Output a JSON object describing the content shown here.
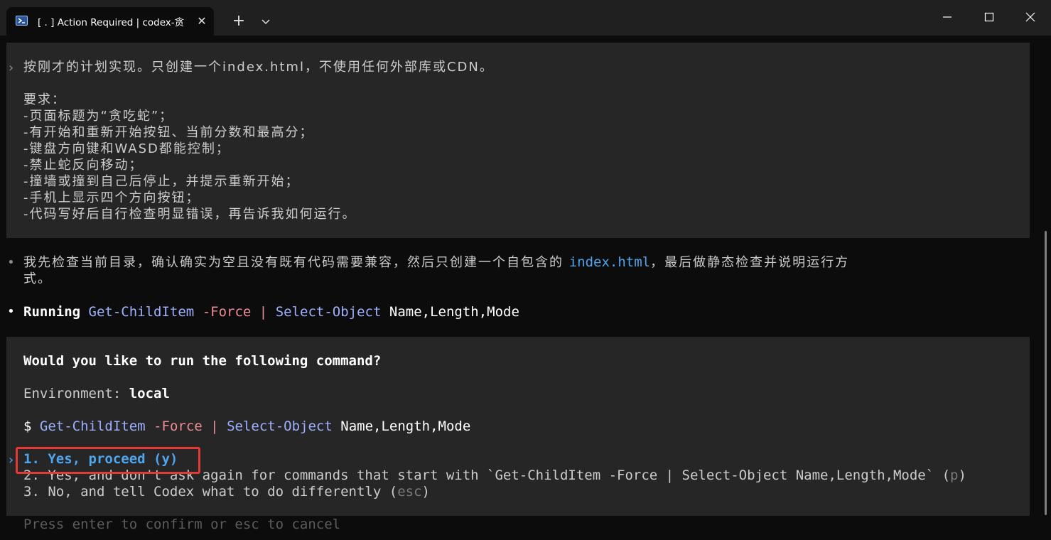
{
  "window": {
    "tab_title": "[ . ] Action Required | codex-贪",
    "tab_close": "✕",
    "new_tab": "+",
    "icons": {
      "tab": "terminal-powershell-icon",
      "dropdown": "chevron-down-icon",
      "minimize": "minimize-icon",
      "maximize": "maximize-icon",
      "close": "close-icon"
    }
  },
  "user_prompt": {
    "marker": "›",
    "first_line": "按刚才的计划实现。只创建一个index.html，不使用任何外部库或CDN。",
    "requirements_title": "要求：",
    "requirements": [
      "-页面标题为“贪吃蛇”；",
      "-有开始和重新开始按钮、当前分数和最高分；",
      "-键盘方向键和WASD都能控制；",
      "-禁止蛇反向移动；",
      "-撞墙或撞到自己后停止，并提示重新开始；",
      "-手机上显示四个方向按钮；",
      "-代码写好后自行检查明显错误，再告诉我如何运行。"
    ]
  },
  "assistant": {
    "bullet": "•",
    "message_part1": "我先检查当前目录，确认确实为空且没有既有代码需要兼容，然后只创建一个自包含的 ",
    "message_file": "index.html",
    "message_part2": "，最后做静态检查并说明运行方",
    "message_line2": "式。",
    "running_label": "Running",
    "cmd_name1": "Get-ChildItem",
    "cmd_flag": "-Force",
    "cmd_pipe": "|",
    "cmd_name2": "Select-Object",
    "cmd_args": "Name,Length,Mode"
  },
  "approval": {
    "question": "Would you like to run the following command?",
    "env_label": "Environment:",
    "env_value": "local",
    "dollar": "$",
    "selected_marker": "›",
    "options": [
      {
        "text": "1. Yes, proceed (y)"
      },
      {
        "text": "2. Yes, and don't ask again for commands that start with `Get-ChildItem -Force | Select-Object Name,Length,Mode` (",
        "key": "p",
        "close": ")"
      },
      {
        "text": "3. No, and tell Codex what to do differently (",
        "key": "esc",
        "close": ")"
      }
    ]
  },
  "footer_hint": "Press enter to confirm or esc to cancel"
}
